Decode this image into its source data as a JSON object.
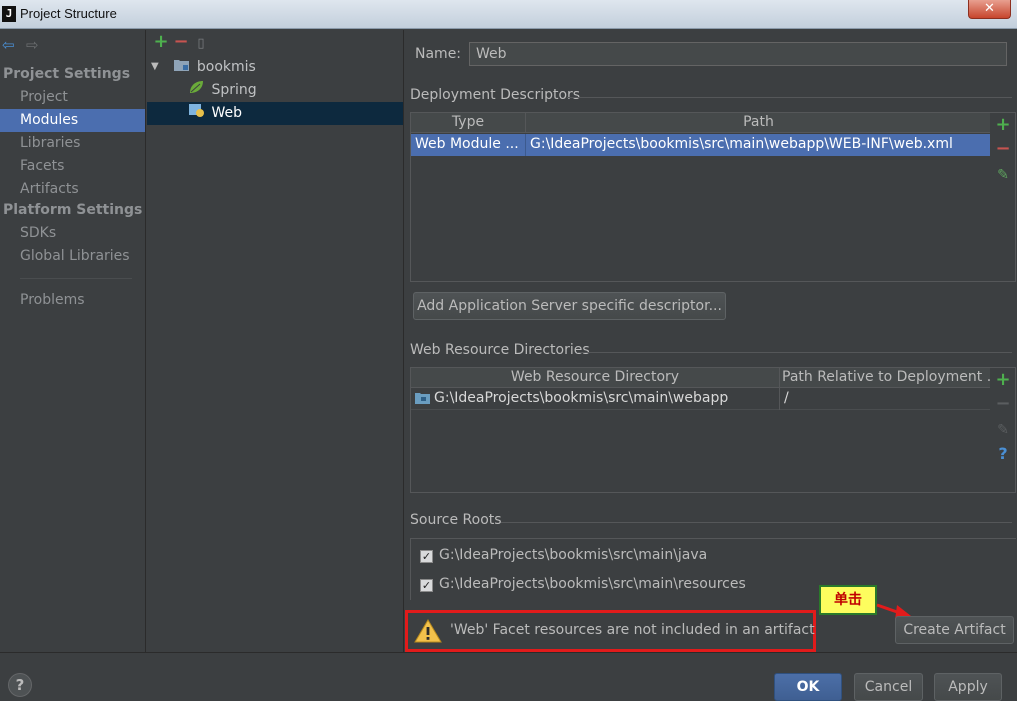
{
  "window": {
    "title": "Project Structure",
    "close_glyph": "✕"
  },
  "nav": {
    "groups": [
      "Project Settings",
      "Platform Settings"
    ],
    "project_items": [
      "Project",
      "Modules",
      "Libraries",
      "Facets",
      "Artifacts"
    ],
    "platform_items": [
      "SDKs",
      "Global Libraries"
    ],
    "problems": "Problems",
    "selected": "Modules"
  },
  "tree": {
    "root": "bookmis",
    "children": [
      "Spring",
      "Web"
    ],
    "selected": "Web"
  },
  "name_field": {
    "label": "Name:",
    "value": "Web"
  },
  "deployment": {
    "title": "Deployment Descriptors",
    "columns": [
      "Type",
      "Path"
    ],
    "rows": [
      {
        "type": "Web Module ...",
        "path": "G:\\IdeaProjects\\bookmis\\src\\main\\webapp\\WEB-INF\\web.xml"
      }
    ],
    "add_button": "Add Application Server specific descriptor..."
  },
  "web_resources": {
    "title": "Web Resource Directories",
    "columns": [
      "Web Resource Directory",
      "Path Relative to Deployment ..."
    ],
    "rows": [
      {
        "dir": "G:\\IdeaProjects\\bookmis\\src\\main\\webapp",
        "rel": "/"
      }
    ]
  },
  "source_roots": {
    "title": "Source Roots",
    "items": [
      {
        "path": "G:\\IdeaProjects\\bookmis\\src\\main\\java",
        "checked": true
      },
      {
        "path": "G:\\IdeaProjects\\bookmis\\src\\main\\resources",
        "checked": true
      }
    ]
  },
  "warning": {
    "text": "'Web' Facet resources are not included in an artifact"
  },
  "create_artifact": "Create Artifact",
  "annotation": {
    "text": "单击"
  },
  "footer": {
    "ok": "OK",
    "cancel": "Cancel",
    "apply": "Apply",
    "help": "?"
  },
  "colors": {
    "selection": "#4b6eaf",
    "background": "#3c3f41",
    "warning_border": "#e21b1b",
    "callout_bg": "#fdfd5e"
  }
}
